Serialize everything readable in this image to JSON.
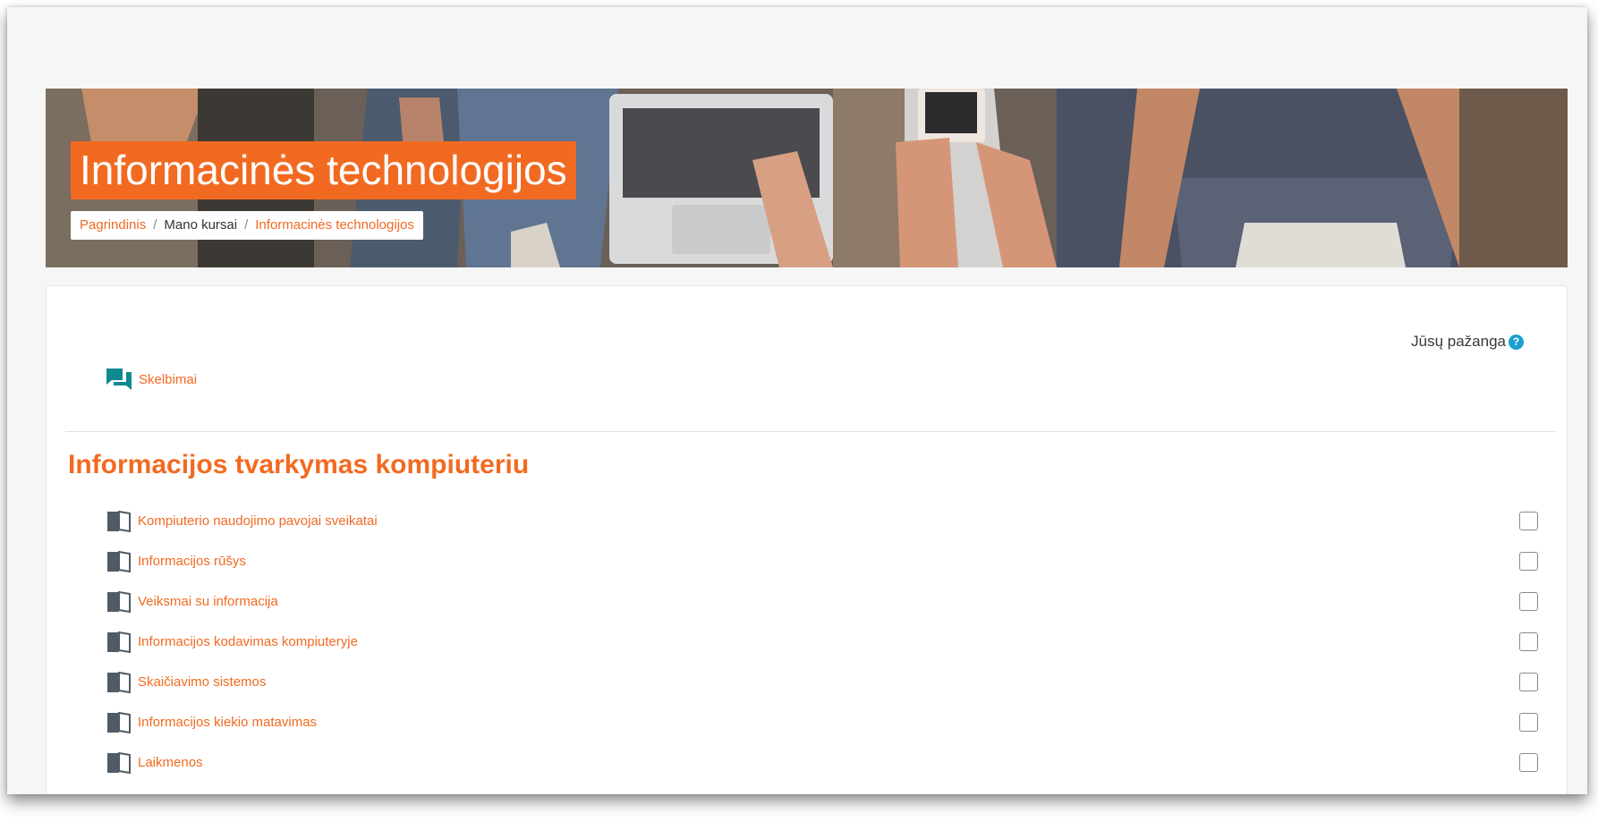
{
  "header": {
    "course_title": "Informacinės technologijos",
    "banner_image": "students-with-laptop-and-phones-photo",
    "breadcrumb": [
      {
        "label": "Pagrindinis",
        "type": "link"
      },
      {
        "label": "Mano kursai",
        "type": "current"
      },
      {
        "label": "Informacinės technologijos",
        "type": "link"
      }
    ],
    "separator": "/"
  },
  "progress": {
    "label": "Jūsų pažanga",
    "help_icon": "question-circle-icon",
    "help_glyph": "?"
  },
  "announcements": {
    "icon": "forum-icon",
    "label": "Skelbimai"
  },
  "section": {
    "title": "Informacijos tvarkymas kompiuteriu",
    "activities": [
      {
        "icon": "book-icon",
        "name": "Kompiuterio naudojimo pavojai sveikatai",
        "completed": false
      },
      {
        "icon": "book-icon",
        "name": "Informacijos rūšys",
        "completed": false
      },
      {
        "icon": "book-icon",
        "name": "Veiksmai su informacija",
        "completed": false
      },
      {
        "icon": "book-icon",
        "name": "Informacijos kodavimas kompiuteryje",
        "completed": false
      },
      {
        "icon": "book-icon",
        "name": "Skaičiavimo sistemos",
        "completed": false
      },
      {
        "icon": "book-icon",
        "name": "Informacijos kiekio matavimas",
        "completed": false
      },
      {
        "icon": "book-icon",
        "name": "Laikmenos",
        "completed": false
      }
    ]
  },
  "colors": {
    "accent": "#f26a21",
    "forum_icon": "#0f8a8f",
    "book_icon": "#4f5b66",
    "help_icon": "#1ca0d0",
    "text": "#373a3c"
  }
}
